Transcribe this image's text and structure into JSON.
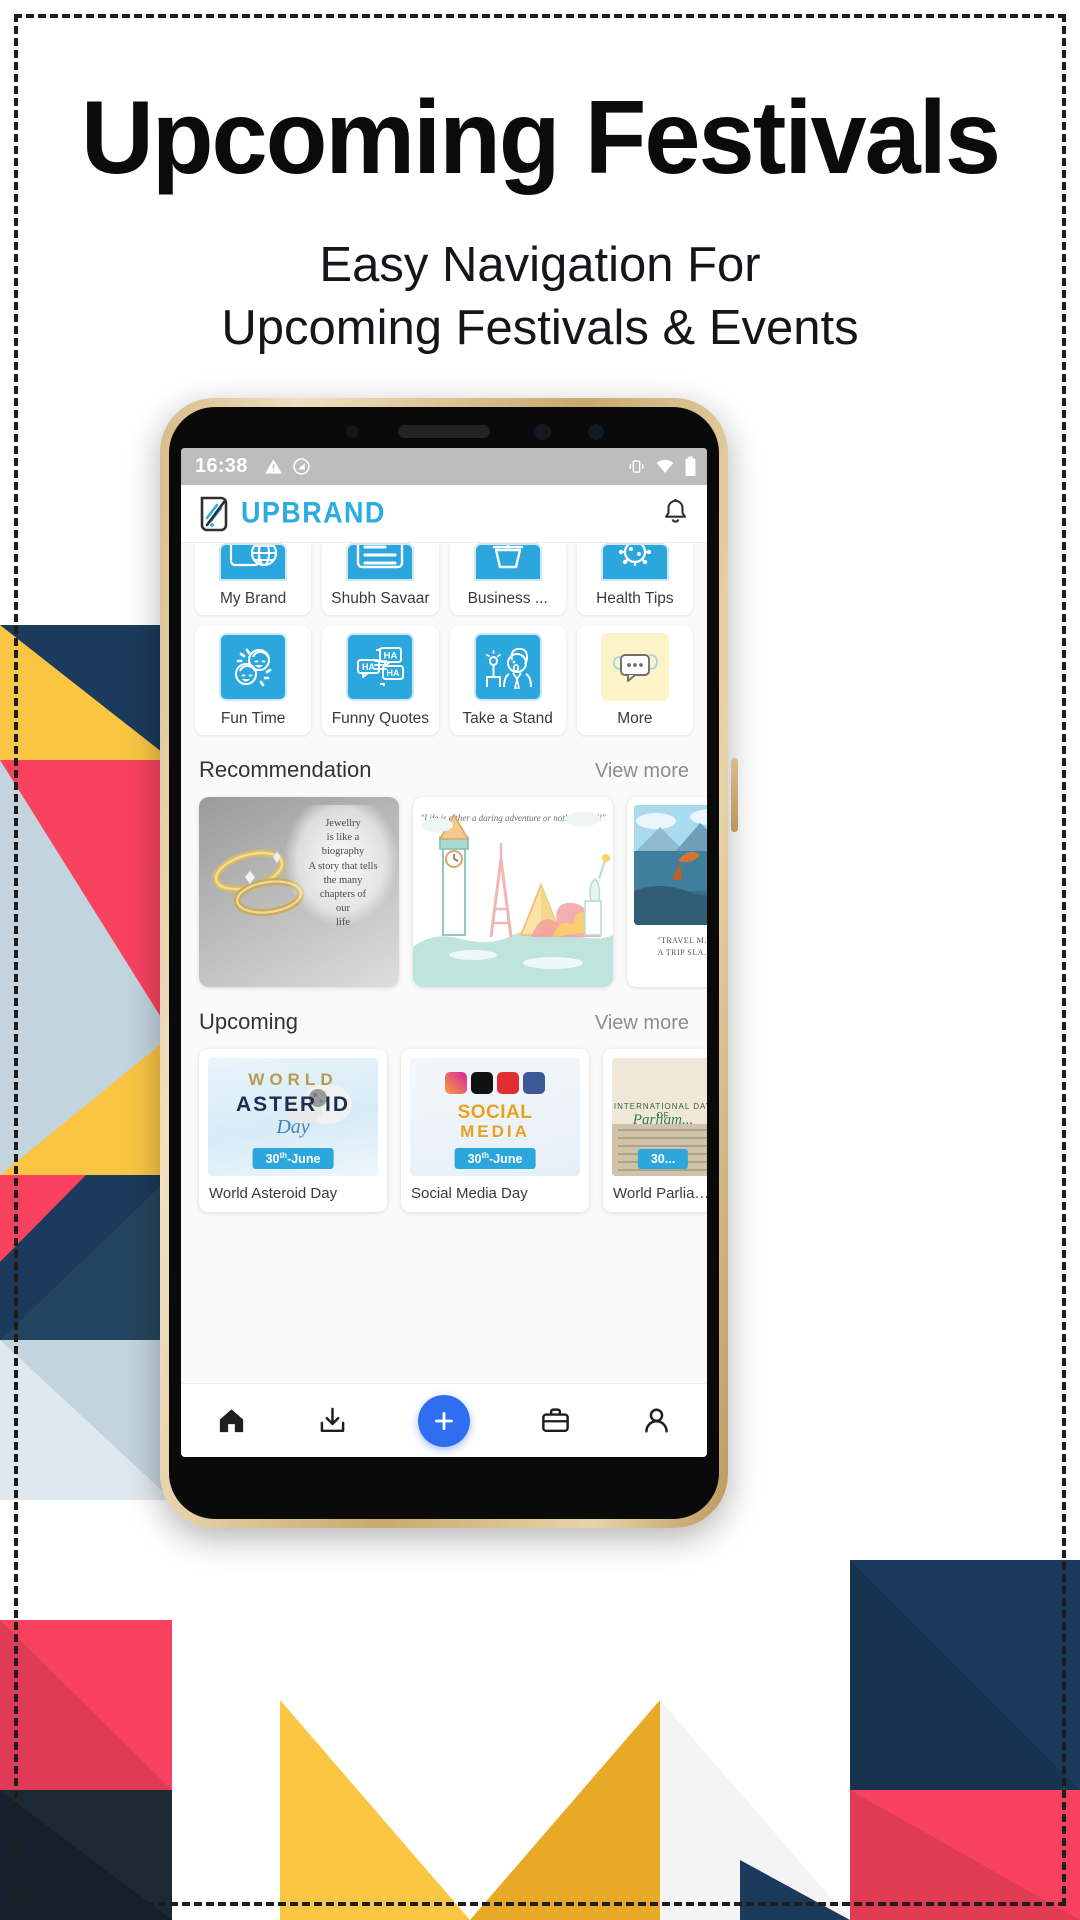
{
  "promo": {
    "title": "Upcoming Festivals",
    "subtitle_line1": "Easy Navigation For",
    "subtitle_line2": "Upcoming Festivals & Events"
  },
  "colors": {
    "brand_blue": "#2bace2",
    "tile_blue": "#2ba7dd",
    "fab_blue": "#2f6ef0",
    "statusbar_gray": "#bdbdbd",
    "screen_bg": "#fafafa",
    "accent_red": "#f8425f",
    "accent_yellow": "#f9c543",
    "accent_navy": "#1b3a5c",
    "accent_lightblue": "#c3d4de"
  },
  "phone": {
    "statusbar": {
      "time": "16:38",
      "left_icons": [
        "warning-triangle-icon",
        "do-not-disturb-icon"
      ],
      "right_icons": [
        "vibrate-icon",
        "wifi-icon",
        "battery-icon"
      ]
    },
    "appbar": {
      "logo_icon": "upbrand-logo-icon",
      "brand": "UPBRAND",
      "notification_icon": "bell-icon"
    },
    "grid": {
      "row1": [
        {
          "label": "My Brand",
          "icon": "globe-card-icon",
          "style": "blue"
        },
        {
          "label": "Shubh Savaar",
          "icon": "text-lines-icon",
          "style": "blue"
        },
        {
          "label": "Business ...",
          "icon": "basket-icon",
          "style": "blue"
        },
        {
          "label": "Health Tips",
          "icon": "virus-icon",
          "style": "blue"
        }
      ],
      "row2": [
        {
          "label": "Fun Time",
          "icon": "laughing-faces-icon",
          "style": "blue"
        },
        {
          "label": "Funny Quotes",
          "icon": "ha-bubbles-icon",
          "style": "blue"
        },
        {
          "label": "Take a Stand",
          "icon": "speaker-person-icon",
          "style": "blue"
        },
        {
          "label": "More",
          "icon": "chat-cloud-icon",
          "style": "yellow"
        }
      ]
    },
    "recommendation": {
      "title": "Recommendation",
      "view_more": "View more",
      "cards": [
        {
          "name": "jewellery-quote-card",
          "quote": "Jewellry is like a biography A story that tells the many chapters of our life"
        },
        {
          "name": "travel-illustration-card",
          "caption": "\"Life is either a daring adventure or nothing at all\""
        },
        {
          "name": "travel-photo-card",
          "caption": "\"TRAVEL M... A TRIP SLA..."
        }
      ]
    },
    "upcoming": {
      "title": "Upcoming",
      "view_more": "View more",
      "cards": [
        {
          "label": "World Asteroid Day",
          "thumb_line1": "WORLD",
          "thumb_line2": "ASTER ID",
          "thumb_line3": "Day",
          "date": "30th-June",
          "date_num": "30",
          "date_sup": "th",
          "date_rest": "-June"
        },
        {
          "label": "Social Media Day",
          "thumb_line1": "SOCIAL",
          "thumb_line2": "MEDIA",
          "date": "30th-June",
          "date_num": "30",
          "date_sup": "th",
          "date_rest": "-June"
        },
        {
          "label": "World  Parliamen",
          "thumb_line1": "INTERNATIONAL DAY OF",
          "thumb_line2": "Parliam...",
          "date": "30...",
          "date_num": "30",
          "date_sup": "",
          "date_rest": "..."
        }
      ]
    },
    "bottom_nav": [
      {
        "name": "home-icon",
        "label": "Home"
      },
      {
        "name": "download-icon",
        "label": "Downloads"
      },
      {
        "name": "plus-icon",
        "label": "Create"
      },
      {
        "name": "briefcase-icon",
        "label": "Business"
      },
      {
        "name": "profile-icon",
        "label": "Profile"
      }
    ]
  }
}
